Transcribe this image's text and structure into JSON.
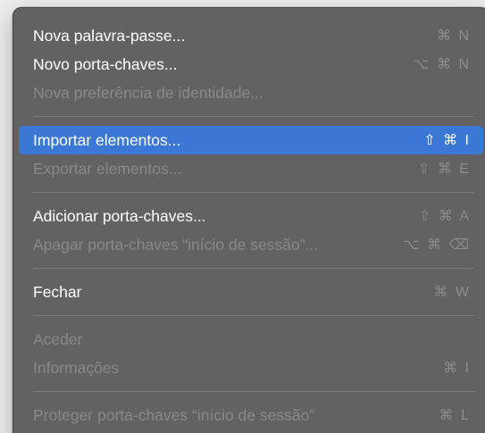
{
  "menu": {
    "items": [
      {
        "label": "Nova palavra-passe...",
        "shortcut": "⌘ N",
        "enabled": true
      },
      {
        "label": "Novo porta-chaves...",
        "shortcut": "⌥ ⌘ N",
        "enabled": true
      },
      {
        "label": "Nova preferência de identidade...",
        "shortcut": "",
        "enabled": false
      },
      {
        "label": "Importar elementos...",
        "shortcut": "⇧ ⌘ I",
        "enabled": true,
        "highlighted": true
      },
      {
        "label": "Exportar elementos...",
        "shortcut": "⇧ ⌘ E",
        "enabled": false
      },
      {
        "label": "Adicionar porta-chaves...",
        "shortcut": "⇧ ⌘ A",
        "enabled": true
      },
      {
        "label": "Apagar porta-chaves “início de sessão”...",
        "shortcut": "⌥ ⌘ ⌫",
        "enabled": false
      },
      {
        "label": "Fechar",
        "shortcut": "⌘ W",
        "enabled": true
      },
      {
        "label": "Aceder",
        "shortcut": "",
        "enabled": false
      },
      {
        "label": "Informações",
        "shortcut": "⌘ I",
        "enabled": false
      },
      {
        "label": "Proteger porta-chaves “início de sessão”",
        "shortcut": "⌘ L",
        "enabled": false
      }
    ]
  },
  "colors": {
    "menu_background": "#626262",
    "highlight": "#3b78d6",
    "text_enabled": "#ffffff",
    "text_disabled": "#898989"
  }
}
